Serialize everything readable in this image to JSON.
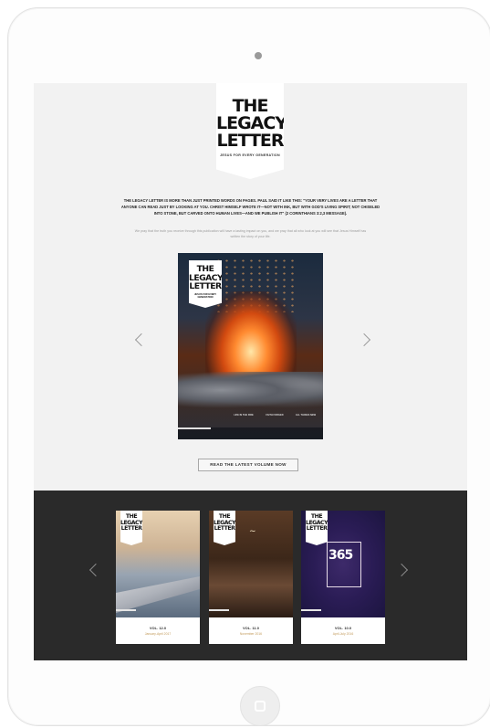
{
  "site": {
    "logo_line1": "THE",
    "logo_line2": "LEGACY",
    "logo_line3": "LETTER",
    "tagline": "JESUS FOR EVERY GENERATION",
    "intro": "THE LEGACY LETTER IS MORE THAN JUST PRINTED WORDS ON PAGES. PAUL SAID IT LIKE THIS: \"YOUR VERY LIVES ARE A LETTER THAT ANYONE CAN READ JUST BY LOOKING AT YOU. CHRIST HIMSELF WROTE IT—NOT WITH INK, BUT WITH GOD'S LIVING SPIRIT; NOT CHISELED INTO STONE, BUT CARVED ONTO HUMAN LIVES—AND WE PUBLISH IT\" (2 CORINTHIANS 3:2,3 MESSAGE).",
    "sub": "We pray that the truth you receive through this publication will have a lasting impact on you, and we pray that all who look at you will see that Jesus Himself has written the story of your life."
  },
  "hero": {
    "columns": [
      "LIFE IN THE FIRE",
      "FAITH FORGED",
      "ALL THINGS NEW"
    ],
    "read_button": "READ THE LATEST VOLUME NOW"
  },
  "volumes": [
    {
      "vol": "VOL. 12.0",
      "date": "January-April 2017"
    },
    {
      "vol": "VOL. 11.0",
      "date": "November 2016"
    },
    {
      "vol": "VOL. 10.0",
      "date": "April-July 2016",
      "cover_number": "365"
    }
  ],
  "colors": {
    "screen_bg": "#f2f2f2",
    "band_bg": "#2a2a2a",
    "date_accent": "#c29a5a"
  },
  "icons": [
    "chevron-left-icon",
    "chevron-right-icon",
    "home-button-icon"
  ]
}
